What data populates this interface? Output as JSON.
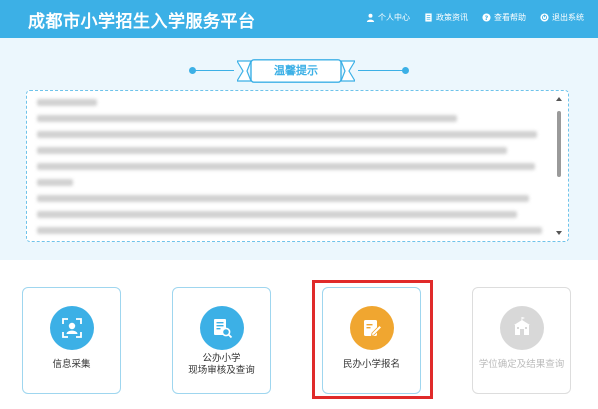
{
  "header": {
    "title": "成都市小学招生入学服务平台",
    "nav": [
      {
        "label": "个人中心",
        "icon": "user-icon"
      },
      {
        "label": "政策资讯",
        "icon": "document-icon"
      },
      {
        "label": "查看帮助",
        "icon": "help-icon"
      },
      {
        "label": "退出系统",
        "icon": "power-icon"
      }
    ]
  },
  "notice": {
    "title": "温馨提示"
  },
  "cards": [
    {
      "label": "信息采集",
      "icon": "info-collect-icon",
      "color": "#3cb0e6",
      "enabled": true
    },
    {
      "label_line1": "公办小学",
      "label_line2": "现场审核及查询",
      "icon": "document-search-icon",
      "color": "#3cb0e6",
      "enabled": true
    },
    {
      "label": "民办小学报名",
      "icon": "edit-icon",
      "color": "#f0a630",
      "enabled": true
    },
    {
      "label": "学位确定及结果查询",
      "icon": "school-icon",
      "color": "#d8d8d8",
      "enabled": false
    }
  ],
  "colors": {
    "header_bg": "#3cb0e6",
    "accent": "#3cb0e6",
    "highlight": "#e02a2a"
  }
}
